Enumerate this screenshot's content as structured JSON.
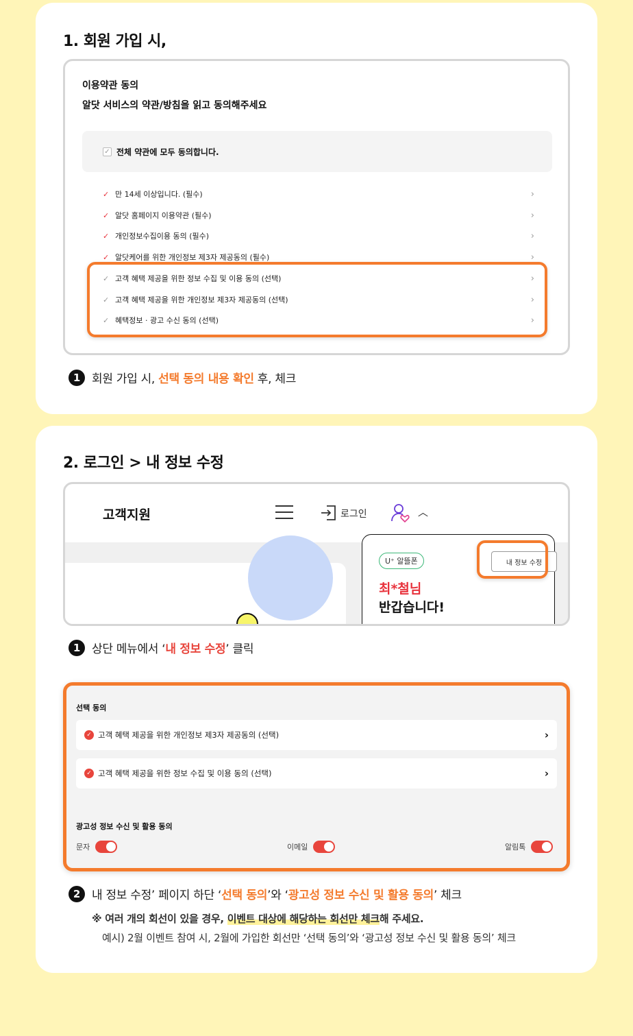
{
  "section1": {
    "title": "1. 회원 가입 시,",
    "terms": {
      "heading1": "이용약관 동의",
      "heading2": "알닷 서비스의 약관/방침을 읽고 동의해주세요",
      "all_agree": "전체 약관에 모두 동의합니다.",
      "items": [
        {
          "label": "만 14세 이상입니다. (필수)",
          "required": true
        },
        {
          "label": "알닷 홈페이지 이용약관 (필수)",
          "required": true
        },
        {
          "label": "개인정보수집이용 동의 (필수)",
          "required": true
        },
        {
          "label": "알닷케어를 위한 개인정보 제3자 제공동의 (필수)",
          "required": true
        },
        {
          "label": "고객 혜택 제공을 위한 정보 수집 및 이용 동의 (선택)",
          "required": false
        },
        {
          "label": "고객 혜택 제공을 위한 개인정보 제3자 제공동의 (선택)",
          "required": false
        },
        {
          "label": "혜택정보 · 광고 수신 동의 (선택)",
          "required": false
        }
      ]
    },
    "note": {
      "num": "1",
      "prefix": "회원 가입 시, ",
      "highlight": "선택 동의 내용 확인",
      "suffix": " 후, 체크"
    }
  },
  "section2": {
    "title": "2. 로그인 > 내 정보 수정",
    "header": {
      "title": "고객지원",
      "login_label": "로그인",
      "caret": "^"
    },
    "dropdown": {
      "badge": "U⁺ 알뜰폰",
      "edit_button": "내 정보 수정",
      "name": "최*철님",
      "greeting": "반갑습니다!"
    },
    "note1": {
      "num": "1",
      "prefix": "상단 메뉴에서 ‘",
      "highlight": "내 정보 수정",
      "suffix": "’ 클릭"
    },
    "consent": {
      "title1": "선택 동의",
      "items": [
        "고객 혜택 제공을 위한 개인정보 제3자 제공동의 (선택)",
        "고객 혜택 제공을 위한 정보 수집 및 이용 동의 (선택)"
      ],
      "title2": "광고성 정보 수신 및 활용 동의",
      "toggles": [
        "문자",
        "이메일",
        "알림톡"
      ]
    },
    "note2": {
      "num": "2",
      "p1": "내 정보 수정’ 페이지 하단 ‘",
      "h1": "선택 동의",
      "p2": "’와 ‘",
      "h2": "광고성 정보 수신 및 활용 동의",
      "p3": "’ 체크"
    },
    "sub_note": {
      "prefix": "※ 여러 개의 회선이 있을 경우, ",
      "mark": "이벤트 대상에 해당하는 회선만 체크",
      "suffix": "해 주세요.",
      "example": "예시) 2월 이벤트 참여 시, 2월에 가입한 회선만 ‘선택 동의’와 ‘광고성 정보 수신 및 활용 동의’ 체크"
    }
  },
  "colors": {
    "background": "#fff5b8",
    "accent_orange": "#f47b2d",
    "accent_red": "#e8453c"
  }
}
